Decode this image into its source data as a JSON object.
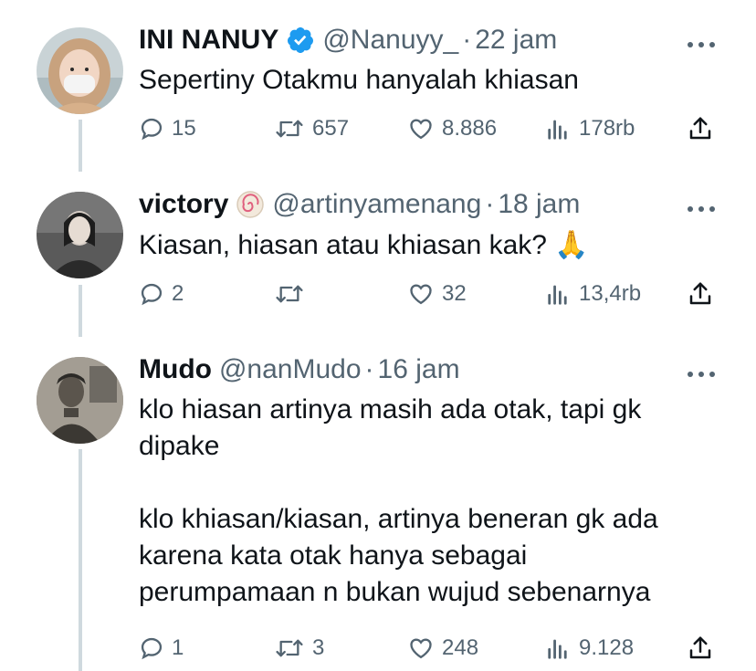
{
  "colors": {
    "text_primary": "#0f1419",
    "text_secondary": "#536471",
    "verified_blue": "#1d9bf0",
    "thread_line": "#cfd9de"
  },
  "tweets": [
    {
      "name": "INI NANUY",
      "handle": "@Nanuyy_",
      "time": "22 jam",
      "badge": "verified-badge-icon",
      "text": "Sepertiny Otakmu hanyalah khiasan",
      "replies": "15",
      "retweets": "657",
      "likes": "8.886",
      "views": "178rb"
    },
    {
      "name": "victory",
      "handle": "@artinyamenang",
      "time": "18 jam",
      "badge": "fish-cake-emoji-icon",
      "text": "Kiasan, hiasan atau khiasan kak? 🙏",
      "replies": "2",
      "retweets": "",
      "likes": "32",
      "views": "13,4rb"
    },
    {
      "name": "Mudo",
      "handle": "@nanMudo",
      "time": "16 jam",
      "badge": "",
      "text": "klo hiasan artinya masih ada otak, tapi gk\ndipake\n\nklo khiasan/kiasan, artinya beneran gk ada\nkarena kata otak hanya sebagai\nperumpamaan n bukan wujud sebenarnya",
      "replies": "1",
      "retweets": "3",
      "likes": "248",
      "views": "9.128"
    }
  ]
}
